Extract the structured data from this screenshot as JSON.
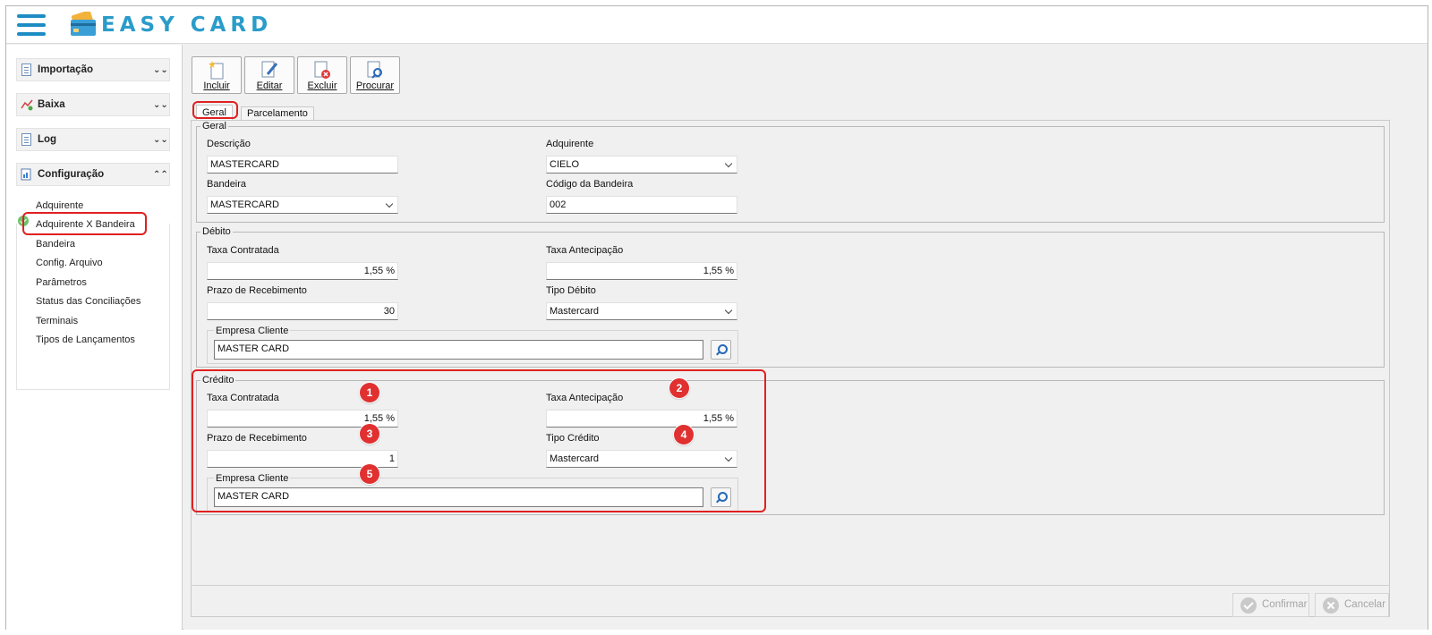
{
  "app": {
    "title": "EASY CARD"
  },
  "sidebar": {
    "sections": [
      {
        "label": "Importação",
        "icon": "document-icon",
        "state": "collapsed"
      },
      {
        "label": "Baixa",
        "icon": "chart-icon",
        "state": "collapsed"
      },
      {
        "label": "Log",
        "icon": "document-icon",
        "state": "collapsed"
      },
      {
        "label": "Configuração",
        "icon": "settings-document-icon",
        "state": "expanded"
      }
    ],
    "items": [
      {
        "label": "Adquirente"
      },
      {
        "label": "Adquirente X Bandeira",
        "selected": true
      },
      {
        "label": "Bandeira"
      },
      {
        "label": "Config. Arquivo"
      },
      {
        "label": "Parâmetros"
      },
      {
        "label": "Status das Conciliações"
      },
      {
        "label": "Terminais"
      },
      {
        "label": "Tipos de Lançamentos"
      }
    ]
  },
  "toolbar": {
    "incluir": "Incluir",
    "editar": "Editar",
    "excluir": "Excluir",
    "procurar": "Procurar"
  },
  "tabs": {
    "geral": "Geral",
    "parcelamento": "Parcelamento",
    "active": "Geral"
  },
  "geral": {
    "legend": "Geral",
    "descricao_label": "Descrição",
    "descricao_value": "MASTERCARD",
    "adquirente_label": "Adquirente",
    "adquirente_value": "CIELO",
    "bandeira_label": "Bandeira",
    "bandeira_value": "MASTERCARD",
    "codigo_label": "Código da Bandeira",
    "codigo_value": "002"
  },
  "debito": {
    "legend": "Débito",
    "taxa_contratada_label": "Taxa Contratada",
    "taxa_contratada_value": "1,55 %",
    "taxa_antecipacao_label": "Taxa Antecipação",
    "taxa_antecipacao_value": "1,55 %",
    "prazo_label": "Prazo de Recebimento",
    "prazo_value": "30",
    "tipo_label": "Tipo Débito",
    "tipo_value": "Mastercard",
    "empresa_label": "Empresa Cliente",
    "empresa_value": "MASTER CARD"
  },
  "credito": {
    "legend": "Crédito",
    "taxa_contratada_label": "Taxa Contratada",
    "taxa_contratada_value": "1,55 %",
    "taxa_antecipacao_label": "Taxa Antecipação",
    "taxa_antecipacao_value": "1,55 %",
    "prazo_label": "Prazo de Recebimento",
    "prazo_value": "1",
    "tipo_label": "Tipo Crédito",
    "tipo_value": "Mastercard",
    "empresa_label": "Empresa Cliente",
    "empresa_value": "MASTER CARD"
  },
  "badges": [
    "1",
    "2",
    "3",
    "4",
    "5"
  ],
  "footer": {
    "confirmar": "Confirmar",
    "cancelar": "Cancelar"
  },
  "colors": {
    "brand": "#2a9cc9",
    "highlight": "#e02020",
    "badge": "#e03030"
  }
}
